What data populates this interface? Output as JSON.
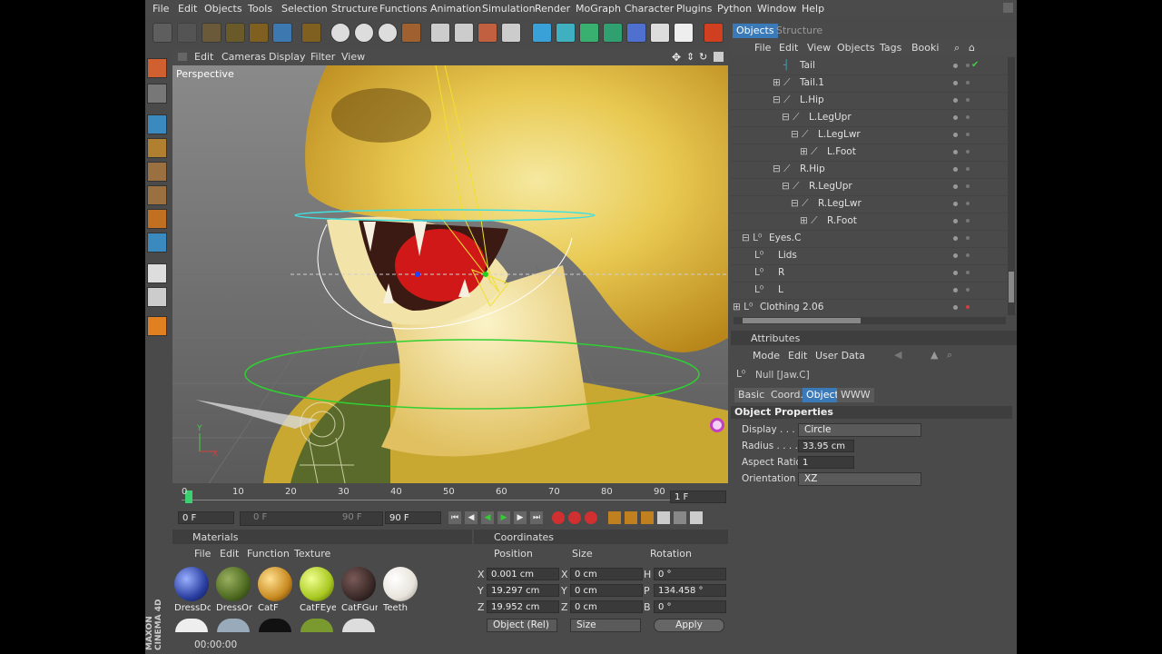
{
  "menu": [
    "File",
    "Edit",
    "Objects",
    "Tools",
    "Selection",
    "Structure",
    "Functions",
    "Animation",
    "Simulation",
    "Render",
    "MoGraph",
    "Character",
    "Plugins",
    "Python",
    "Window",
    "Help"
  ],
  "viewport": {
    "menu": [
      "Edit",
      "Cameras",
      "Display",
      "Filter",
      "View"
    ],
    "label": "Perspective"
  },
  "panel_tabs": {
    "objects": "Objects",
    "structure": "Structure"
  },
  "obj_menu": [
    "File",
    "Edit",
    "View",
    "Objects",
    "Tags",
    "Booki"
  ],
  "objects": [
    {
      "label": "Tail"
    },
    {
      "label": "Tail.1"
    },
    {
      "label": "L.Hip"
    },
    {
      "label": "L.LegUpr"
    },
    {
      "label": "L.LegLwr"
    },
    {
      "label": "L.Foot"
    },
    {
      "label": "R.Hip"
    },
    {
      "label": "R.LegUpr"
    },
    {
      "label": "R.LegLwr"
    },
    {
      "label": "R.Foot"
    },
    {
      "label": "Eyes.C"
    },
    {
      "label": "Lids"
    },
    {
      "label": "R"
    },
    {
      "label": "L"
    },
    {
      "label": "Clothing 2.06"
    }
  ],
  "attributes": {
    "title": "Attributes",
    "menu": [
      "Mode",
      "Edit",
      "User Data"
    ],
    "object_name": "Null [Jaw.C]",
    "tabs": [
      "Basic",
      "Coord.",
      "Object",
      "WWW"
    ],
    "section": "Object Properties",
    "props": [
      {
        "label": "Display . . . .",
        "value": "Circle"
      },
      {
        "label": "Radius . . . . .",
        "value": "33.95 cm"
      },
      {
        "label": "Aspect Ratio",
        "value": "1"
      },
      {
        "label": "Orientation",
        "value": "XZ"
      }
    ]
  },
  "timeline": {
    "ticks": [
      "0",
      "10",
      "20",
      "30",
      "40",
      "50",
      "60",
      "70",
      "80",
      "90"
    ],
    "current": "1 F",
    "start": "0 F",
    "range_start": "0 F",
    "range_end": "90 F",
    "end": "90 F"
  },
  "materials": {
    "title": "Materials",
    "menu": [
      "File",
      "Edit",
      "Function",
      "Texture"
    ],
    "items": [
      {
        "name": "DressDo",
        "color": "#2a3fa0"
      },
      {
        "name": "DressOn",
        "color": "#4e6a20"
      },
      {
        "name": "CatF",
        "color": "#c88a20"
      },
      {
        "name": "CatFEye",
        "color": "#a8c820"
      },
      {
        "name": "CatFGum",
        "color": "#3a2a28"
      },
      {
        "name": "Teeth",
        "color": "#e8e4dc"
      }
    ]
  },
  "coordinates": {
    "title": "Coordinates",
    "headers": [
      "Position",
      "Size",
      "Rotation"
    ],
    "rows": [
      {
        "axis": "X",
        "pos": "0.001 cm",
        "saxis": "X",
        "size": "0 cm",
        "raxis": "H",
        "rot": "0 °"
      },
      {
        "axis": "Y",
        "pos": "19.297 cm",
        "saxis": "Y",
        "size": "0 cm",
        "raxis": "P",
        "rot": "134.458 °"
      },
      {
        "axis": "Z",
        "pos": "19.952 cm",
        "saxis": "Z",
        "size": "0 cm",
        "raxis": "B",
        "rot": "0 °"
      }
    ],
    "mode": "Object (Rel)",
    "size_mode": "Size",
    "apply": "Apply"
  },
  "status": "00:00:00",
  "brand": "MAXON CINEMA 4D"
}
